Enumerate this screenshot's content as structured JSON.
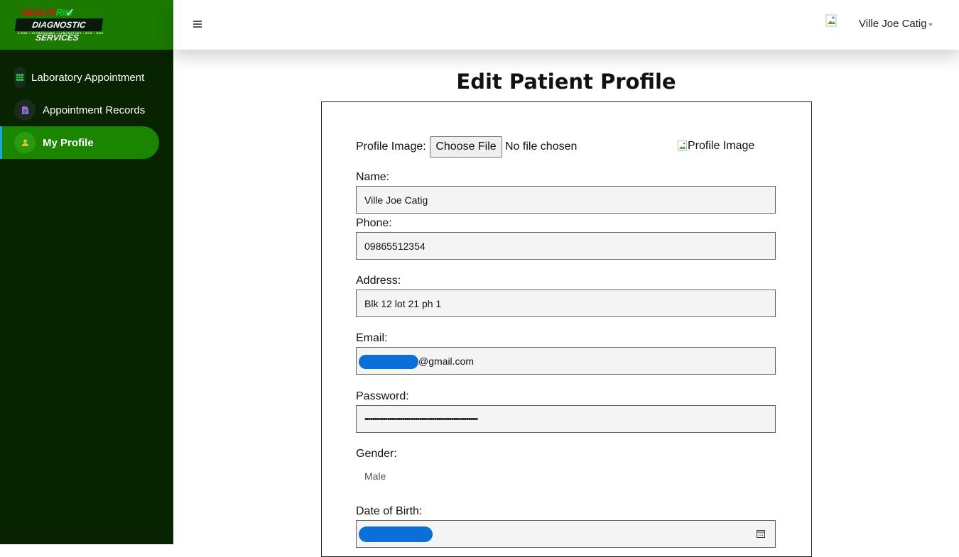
{
  "brand": {
    "line1_a": "HEALTH",
    "line1_b": "Rite",
    "line2": "DIAGNOSTIC SERVICES",
    "line3": "X-RAY • ULTRASOUND • LABORATORY • ECG • DRUG TEST"
  },
  "sidebar": {
    "items": [
      {
        "label": "Laboratory Appointment",
        "icon": "calendar-grid-icon",
        "icon_color": "#2ecc40"
      },
      {
        "label": "Appointment Records",
        "icon": "document-icon",
        "icon_color": "#9b6fe0"
      },
      {
        "label": "My Profile",
        "icon": "user-icon",
        "icon_color": "#f0c020",
        "active": true
      }
    ]
  },
  "topbar": {
    "username": "Ville Joe Catig"
  },
  "page": {
    "title": "Edit Patient Profile"
  },
  "form": {
    "profile_image_label": "Profile Image:",
    "choose_file_label": "Choose File",
    "file_status": "No file chosen",
    "profile_image_alt": "Profile Image",
    "name_label": "Name:",
    "name_value": "Ville Joe Catig",
    "phone_label": "Phone:",
    "phone_value": "09865512354",
    "address_label": "Address:",
    "address_value": "Blk 12 lot 21 ph 1",
    "email_label": "Email:",
    "email_value": "@gmail.com",
    "password_label": "Password:",
    "password_value": "••••••••••••••••••••••••••••••••••••••••••••••••••••••••••••",
    "gender_label": "Gender:",
    "gender_value": "Male",
    "dob_label": "Date of Birth:"
  },
  "colors": {
    "sidebar_bg": "#072300",
    "logo_bg": "#1b7a00",
    "active_item_bg": "#1b8500",
    "active_indicator": "#1aa6e0",
    "redaction": "#0a6fd6"
  }
}
